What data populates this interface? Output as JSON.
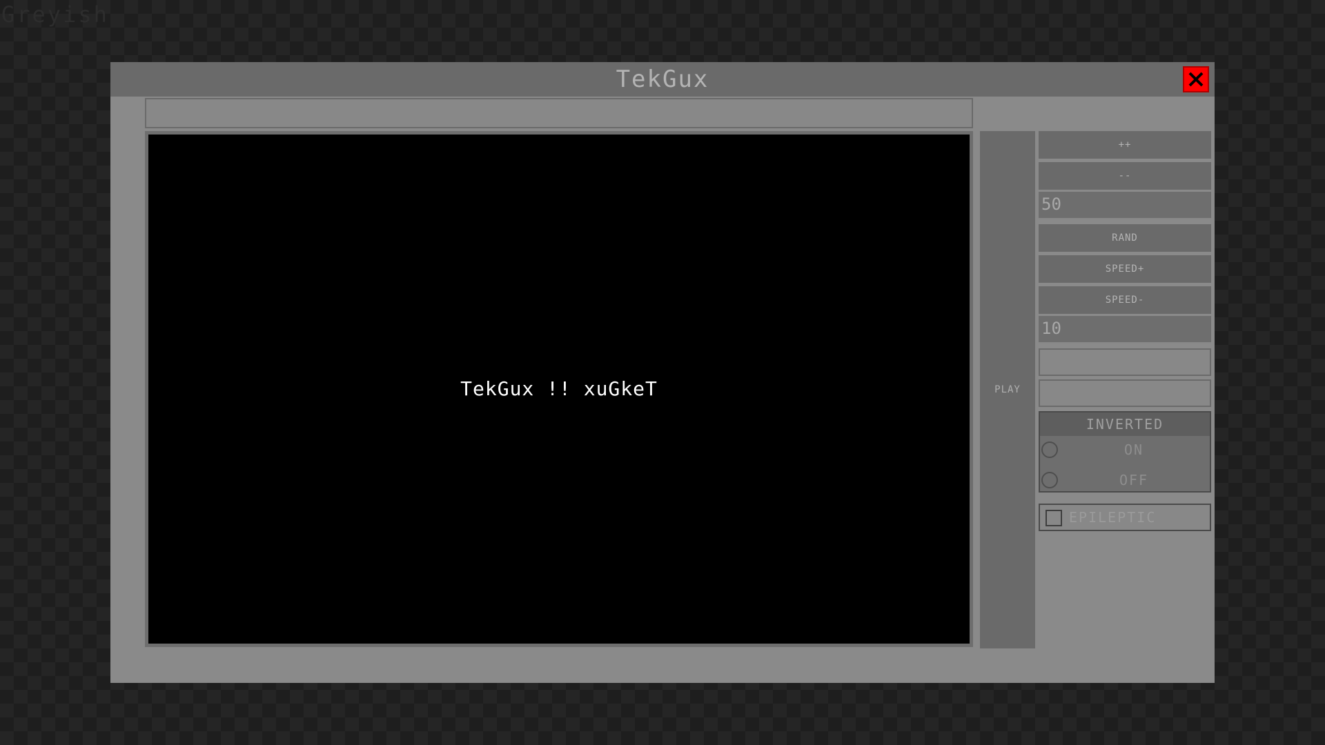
{
  "desktop": {
    "theme_label": "Greyish"
  },
  "window": {
    "title": "TekGux",
    "close_icon": "close-icon",
    "colors": {
      "close_button": "#ff0000",
      "titlebar": "#6a6a6a",
      "window_body": "#8a8a8a",
      "canvas": "#000000"
    }
  },
  "canvas": {
    "text": "TekGux !! xuGkeT"
  },
  "play_button": {
    "label": "PLAY"
  },
  "controls": {
    "increment_label": "++",
    "decrement_label": "--",
    "count_value": "50",
    "random_label": "RAND",
    "speed_up_label": "SPEED+",
    "speed_down_label": "SPEED-",
    "speed_value": "10"
  },
  "inverted": {
    "header": "INVERTED",
    "options": [
      {
        "label": "ON",
        "selected": false
      },
      {
        "label": "OFF",
        "selected": false
      }
    ]
  },
  "epileptic": {
    "label": "EPILEPTIC",
    "checked": false
  }
}
